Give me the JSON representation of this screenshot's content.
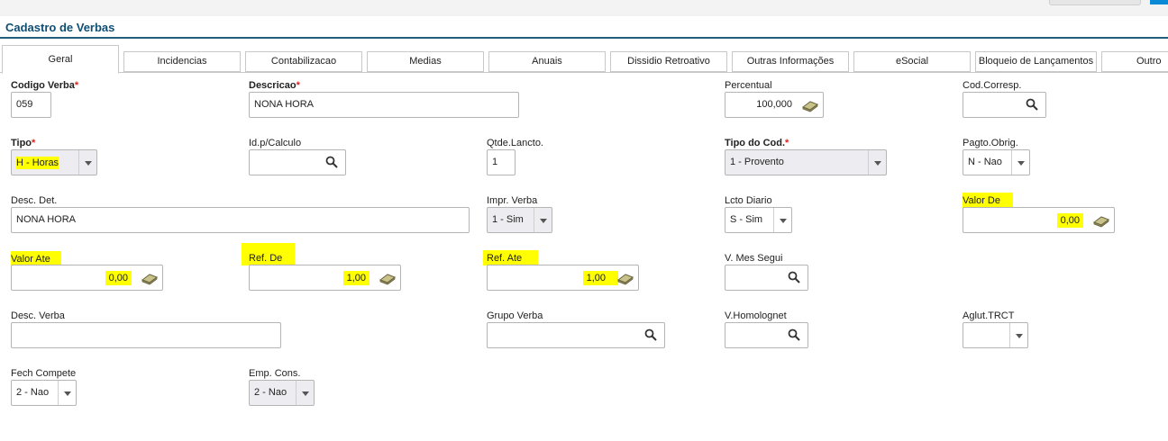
{
  "page_title": "Cadastro de Verbas",
  "tabs": [
    "Geral",
    "Incidencias",
    "Contabilizacao",
    "Medias",
    "Anuais",
    "Dissidio Retroativo",
    "Outras Informações",
    "eSocial",
    "Bloqueio de Lançamentos",
    "Outro"
  ],
  "fields": {
    "codigo_verba": {
      "label": "Codigo Verba",
      "value": "059"
    },
    "descricao": {
      "label": "Descricao",
      "value": "NONA HORA"
    },
    "percentual": {
      "label": "Percentual",
      "value": "100,000"
    },
    "cod_corresp": {
      "label": "Cod.Corresp.",
      "value": ""
    },
    "tipo": {
      "label": "Tipo",
      "value": "H - Horas"
    },
    "id_calculo": {
      "label": "Id.p/Calculo",
      "value": ""
    },
    "qtde_lancto": {
      "label": "Qtde.Lancto.",
      "value": "1"
    },
    "tipo_cod": {
      "label": "Tipo do Cod.",
      "value": "1 - Provento"
    },
    "pagto_obrig": {
      "label": "Pagto.Obrig.",
      "value": "N - Nao"
    },
    "desc_det": {
      "label": "Desc. Det.",
      "value": "NONA HORA"
    },
    "impr_verba": {
      "label": "Impr. Verba",
      "value": "1 - Sim"
    },
    "lcto_diario": {
      "label": "Lcto Diario",
      "value": "S - Sim"
    },
    "valor_de": {
      "label": "Valor De",
      "value": "0,00"
    },
    "valor_ate": {
      "label": "Valor Ate",
      "value": "0,00"
    },
    "ref_de": {
      "label": "Ref. De",
      "value": "1,00"
    },
    "ref_ate": {
      "label": "Ref. Ate",
      "value": "1,00"
    },
    "v_mes_segui": {
      "label": "V. Mes Segui",
      "value": ""
    },
    "desc_verba": {
      "label": "Desc. Verba",
      "value": ""
    },
    "grupo_verba": {
      "label": "Grupo Verba",
      "value": ""
    },
    "v_homolognet": {
      "label": "V.Homolognet",
      "value": ""
    },
    "aglut_trct": {
      "label": "Aglut.TRCT",
      "value": ""
    },
    "fech_compete": {
      "label": "Fech Compete",
      "value": "2 - Nao"
    },
    "emp_cons": {
      "label": "Emp. Cons.",
      "value": "2 - Nao"
    }
  },
  "required_mark": "*",
  "colors": {
    "title": "#0e4e73",
    "required": "#d22222",
    "highlight": "#ffff00",
    "title_rule": "#1f5f7a"
  },
  "icons": {
    "lookup": "search-icon",
    "calculator": "calculator-icon",
    "dropdown": "chevron-down-icon"
  }
}
